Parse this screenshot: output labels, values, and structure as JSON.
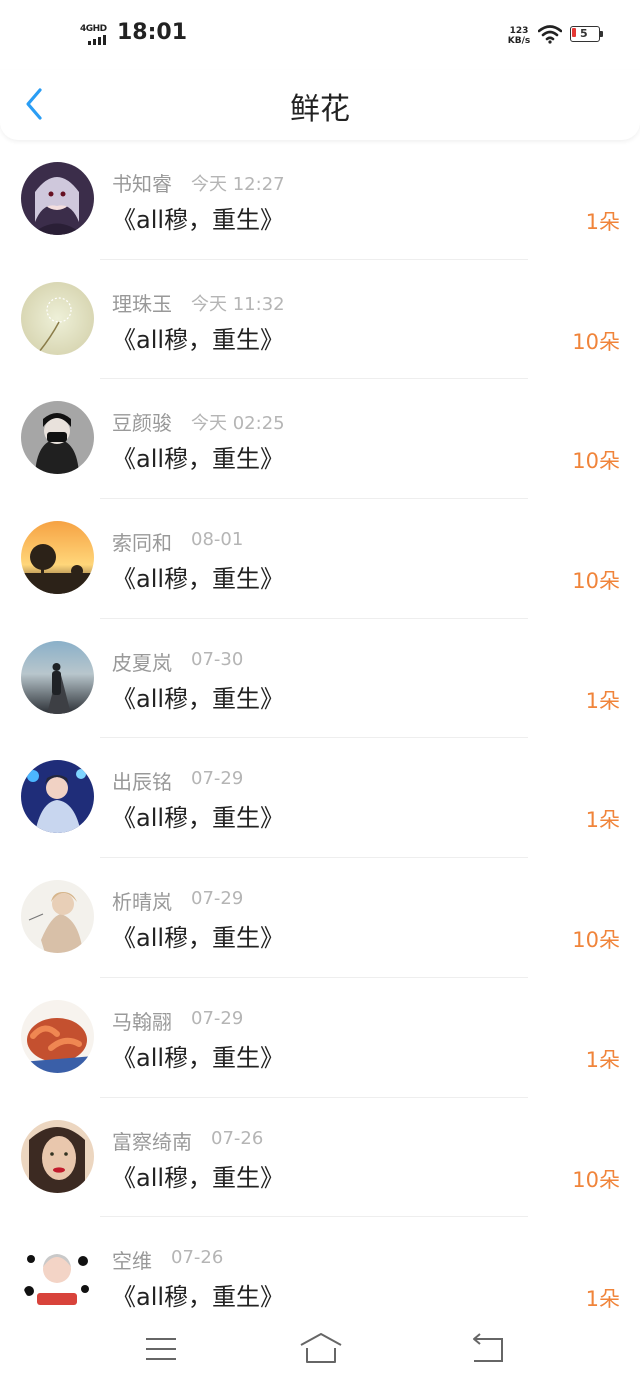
{
  "status_bar": {
    "network": "4GHD",
    "time": "18:01",
    "speed_value": "123",
    "speed_unit": "KB/s",
    "battery_level": "5",
    "battery_color": "#e53935"
  },
  "header": {
    "title": "鲜花",
    "accent_color": "#2a9df4"
  },
  "rows": [
    {
      "name": "书知睿",
      "time": "今天 12:27",
      "title": "《all穆，重生》",
      "flowers": "1朵",
      "avatar": "anime-girl-avatar"
    },
    {
      "name": "理珠玉",
      "time": "今天 11:32",
      "title": "《all穆，重生》",
      "flowers": "10朵",
      "avatar": "dandelion-avatar"
    },
    {
      "name": "豆颜骏",
      "time": "今天 02:25",
      "title": "《all穆，重生》",
      "flowers": "10朵",
      "avatar": "masked-person-avatar"
    },
    {
      "name": "索同和",
      "time": "08-01",
      "title": "《all穆，重生》",
      "flowers": "10朵",
      "avatar": "sunset-tree-avatar"
    },
    {
      "name": "皮夏岚",
      "time": "07-30",
      "title": "《all穆，重生》",
      "flowers": "1朵",
      "avatar": "road-night-avatar"
    },
    {
      "name": "出辰铭",
      "time": "07-29",
      "title": "《all穆，重生》",
      "flowers": "1朵",
      "avatar": "stage-person-avatar"
    },
    {
      "name": "析晴岚",
      "time": "07-29",
      "title": "《all穆，重生》",
      "flowers": "10朵",
      "avatar": "woman-portrait-avatar"
    },
    {
      "name": "马翰翮",
      "time": "07-29",
      "title": "《all穆，重生》",
      "flowers": "1朵",
      "avatar": "shrimp-dish-avatar"
    },
    {
      "name": "富察绮南",
      "time": "07-26",
      "title": "《all穆，重生》",
      "flowers": "10朵",
      "avatar": "red-lips-woman-avatar"
    },
    {
      "name": "空维",
      "time": "07-26",
      "title": "《all穆，重生》",
      "flowers": "1朵",
      "avatar": "dalmatian-pattern-avatar"
    }
  ],
  "bottom_nav": {
    "menu_icon": "menu-icon",
    "home_icon": "home-icon",
    "back_icon": "back-arrow-icon"
  },
  "colors": {
    "flower_count": "#f0843a",
    "name": "#999999",
    "date": "#b5b5b5"
  }
}
